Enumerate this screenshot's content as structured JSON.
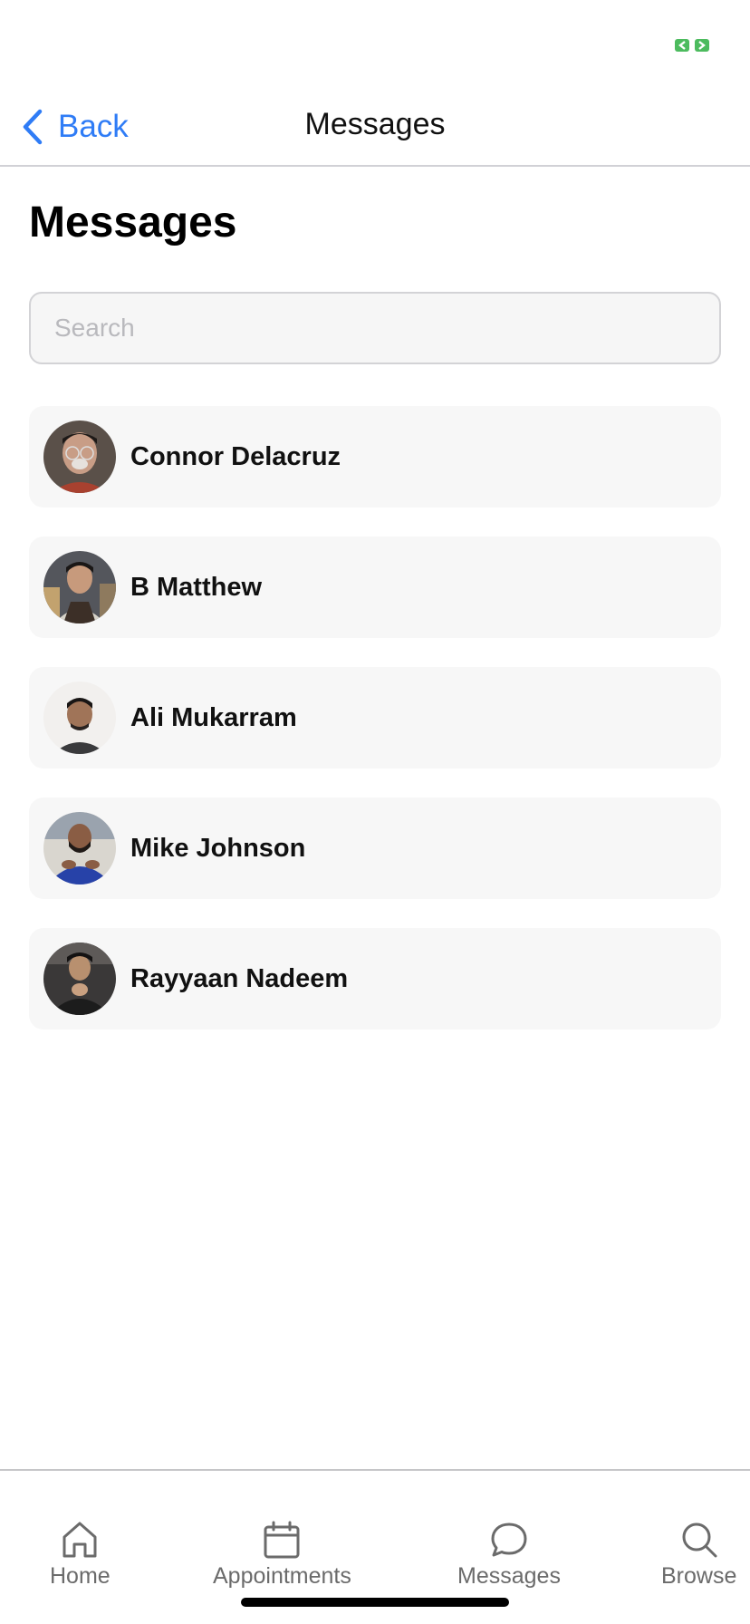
{
  "nav": {
    "back_label": "Back",
    "title": "Messages"
  },
  "page": {
    "title": "Messages"
  },
  "search": {
    "placeholder": "Search",
    "value": ""
  },
  "contacts": [
    {
      "name": "Connor Delacruz",
      "avatar_color": "#8a6a52"
    },
    {
      "name": "B Matthew",
      "avatar_color": "#4a4f58"
    },
    {
      "name": "Ali Mukarram",
      "avatar_color": "#e8e6e3"
    },
    {
      "name": "Mike Johnson",
      "avatar_color": "#2a3f8f"
    },
    {
      "name": "Rayyaan Nadeem",
      "avatar_color": "#2b2b2b"
    }
  ],
  "tabs": [
    {
      "label": "Home",
      "icon": "home-icon"
    },
    {
      "label": "Appointments",
      "icon": "calendar-icon"
    },
    {
      "label": "Messages",
      "icon": "message-icon"
    },
    {
      "label": "Browse",
      "icon": "search-icon"
    }
  ],
  "colors": {
    "accent": "#2f7cf6",
    "status_indicator": "#4cbb5e",
    "card_bg": "#f7f7f7",
    "tab_inactive": "#6b6b6b"
  }
}
